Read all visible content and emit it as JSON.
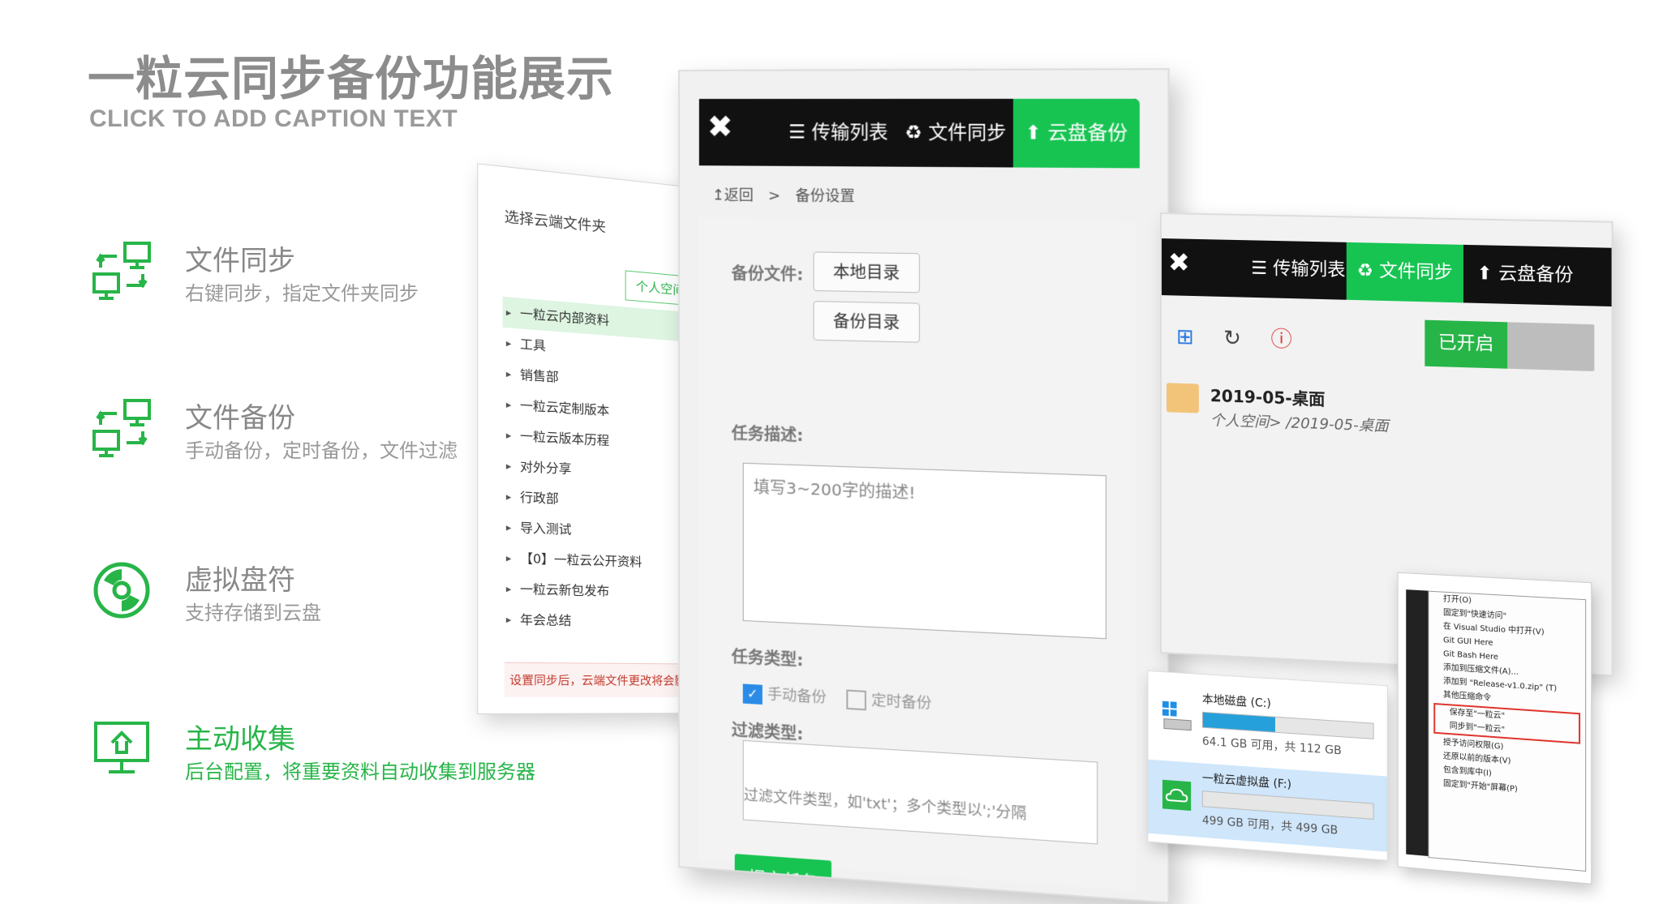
{
  "slide": {
    "title": "一粒云同步备份功能展示",
    "caption": "CLICK TO ADD CAPTION TEXT"
  },
  "features": [
    {
      "title": "文件同步",
      "desc": "右键同步，指定文件夹同步",
      "icon": "sync-icon",
      "active": false
    },
    {
      "title": "文件备份",
      "desc": "手动备份，定时备份，文件过滤",
      "icon": "sync-icon",
      "active": false
    },
    {
      "title": "虚拟盘符",
      "desc": "支持存储到云盘",
      "icon": "disc-icon",
      "active": false
    },
    {
      "title": "主动收集",
      "desc": "后台配置，将重要资料自动收集到服务器",
      "icon": "monitor-upload-icon",
      "active": true
    }
  ],
  "colors": {
    "accent": "#17c452",
    "text_green": "#27b548",
    "gray": "#8c8c8c",
    "dark_bar": "#111111"
  },
  "folder_picker": {
    "header": "选择云端文件夹",
    "chip": "个人空间",
    "items": [
      "一粒云内部资料",
      "工具",
      "销售部",
      "一粒云定制版本",
      "一粒云版本历程",
      "对外分享",
      "行政部",
      "导入测试",
      "【0】一粒云公开资料",
      "一粒云新包发布",
      "年会总结"
    ],
    "warning": "设置同步后，云端文件更改将会影响本地"
  },
  "backup_panel": {
    "tabs": [
      "传输列表",
      "文件同步",
      "云盘备份"
    ],
    "active_tab": "云盘备份",
    "breadcrumb_back": "↥返回",
    "breadcrumb_sep": ">",
    "breadcrumb_current": "备份设置",
    "backup_files_label": "备份文件:",
    "local_dir_button": "本地目录",
    "backup_dir_button": "备份目录",
    "task_desc_label": "任务描述:",
    "task_desc_placeholder": "填写3~200字的描述!",
    "task_type_label": "任务类型:",
    "manual_backup": "手动备份",
    "scheduled_backup": "定时备份",
    "filter_label": "过滤类型:",
    "filter_placeholder": "过滤文件类型，如'txt'；多个类型以';'分隔",
    "submit_button": "提交任务"
  },
  "sync_panel": {
    "tabs": [
      "传输列表",
      "文件同步",
      "云盘备份"
    ],
    "active_tab": "文件同步",
    "toggle_label": "已开启",
    "folder_name": "2019-05-桌面",
    "folder_path": "个人空间> /2019-05-桌面"
  },
  "drives": [
    {
      "name": "本地磁盘 (C:)",
      "free": "64.1 GB 可用，共 112 GB",
      "used_fraction": 0.43
    },
    {
      "name": "一粒云虚拟盘 (F:)",
      "free": "499 GB 可用，共 499 GB",
      "used_fraction": 0.0
    }
  ],
  "context_menu": {
    "items": [
      "打开(O)",
      "固定到\"快速访问\"",
      "在 Visual Studio 中打开(V)",
      "Git GUI Here",
      "Git Bash Here",
      "添加到压缩文件(A)...",
      "添加到 \"Release-v1.0.zip\" (T)",
      "其他压缩命令",
      "保存至\"一粒云\"",
      "同步到\"一粒云\"",
      "授予访问权限(G)",
      "还原以前的版本(V)",
      "包含到库中(I)",
      "固定到\"开始\"屏幕(P)"
    ],
    "highlighted": [
      "保存至\"一粒云\"",
      "同步到\"一粒云\""
    ]
  }
}
